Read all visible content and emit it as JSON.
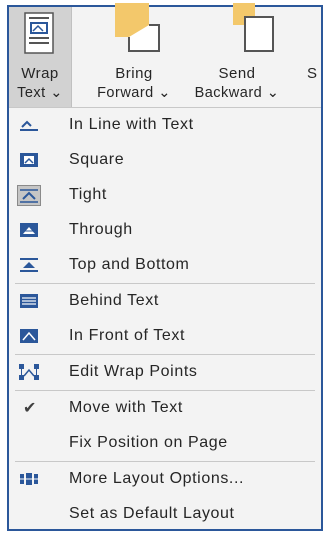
{
  "ribbon": {
    "wrap_text": {
      "line1": "Wrap",
      "line2": "Text",
      "caret": "⌄"
    },
    "bring_forward": {
      "line1": "Bring",
      "line2": "Forward",
      "caret": "⌄"
    },
    "send_backward": {
      "line1": "Send",
      "line2": "Backward",
      "caret": "⌄"
    },
    "selection": {
      "line1": "S"
    }
  },
  "menu": {
    "items": [
      {
        "label": "In Line with Text",
        "icon": "inline-text-icon"
      },
      {
        "label": "Square",
        "icon": "square-wrap-icon"
      },
      {
        "label": "Tight",
        "icon": "tight-wrap-icon"
      },
      {
        "label": "Through",
        "icon": "through-wrap-icon"
      },
      {
        "label": "Top and Bottom",
        "icon": "top-bottom-wrap-icon"
      },
      {
        "label": "Behind Text",
        "icon": "behind-text-icon"
      },
      {
        "label": "In Front of Text",
        "icon": "front-text-icon"
      },
      {
        "label": "Edit Wrap Points",
        "icon": "edit-wrap-points-icon"
      },
      {
        "label": "Move with Text",
        "icon": "checkmark-icon",
        "check": "✔"
      },
      {
        "label": "Fix Position on Page",
        "icon": ""
      },
      {
        "label": "More Layout Options...",
        "icon": "layout-options-icon"
      },
      {
        "label": "Set as Default Layout",
        "icon": ""
      }
    ]
  },
  "colors": {
    "accent": "#2b579a",
    "icon_blue": "#2b579a",
    "ribbon_orange": "#f3c86b"
  }
}
